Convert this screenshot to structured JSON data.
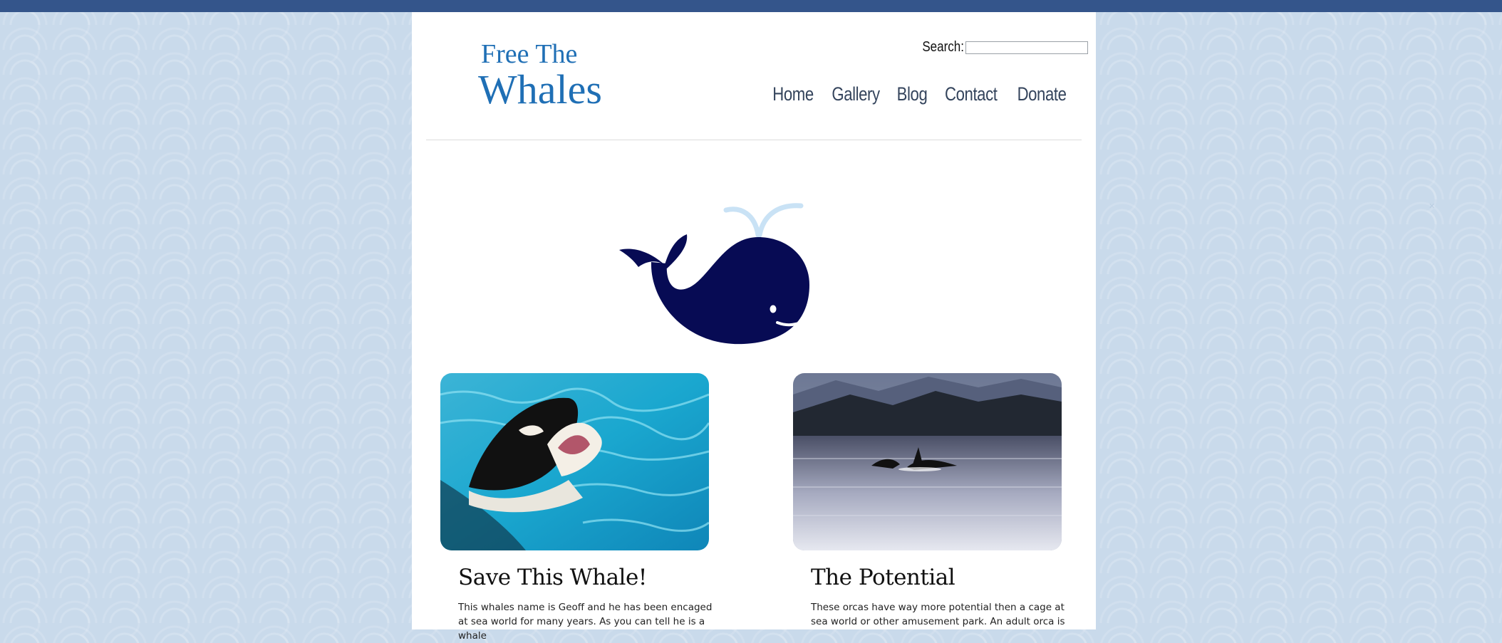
{
  "site": {
    "logo_line1": "Free The",
    "logo_line2": "Whales"
  },
  "search": {
    "label": "Search:",
    "value": "",
    "placeholder": ""
  },
  "nav": {
    "items": [
      "Home",
      "Gallery",
      "Blog",
      "Contact",
      "Donate"
    ]
  },
  "cards": [
    {
      "title": "Save This Whale!",
      "text": "This whales name is Geoff and he has been encaged at sea world for many years. As you can tell he is a whale"
    },
    {
      "title": "The Potential",
      "text": "These orcas have way more potential then a cage at sea world or other amusement park. An adult orca is"
    }
  ],
  "colors": {
    "topbar": "#34558b",
    "background": "#c9daeb",
    "logo": "#1f6fb5",
    "nav_text": "#34445c",
    "mascot": "#070b54",
    "spout": "#c9e2f5"
  },
  "icons": {
    "mascot": "whale-mascot-icon",
    "watermark": "watermark-icon"
  }
}
